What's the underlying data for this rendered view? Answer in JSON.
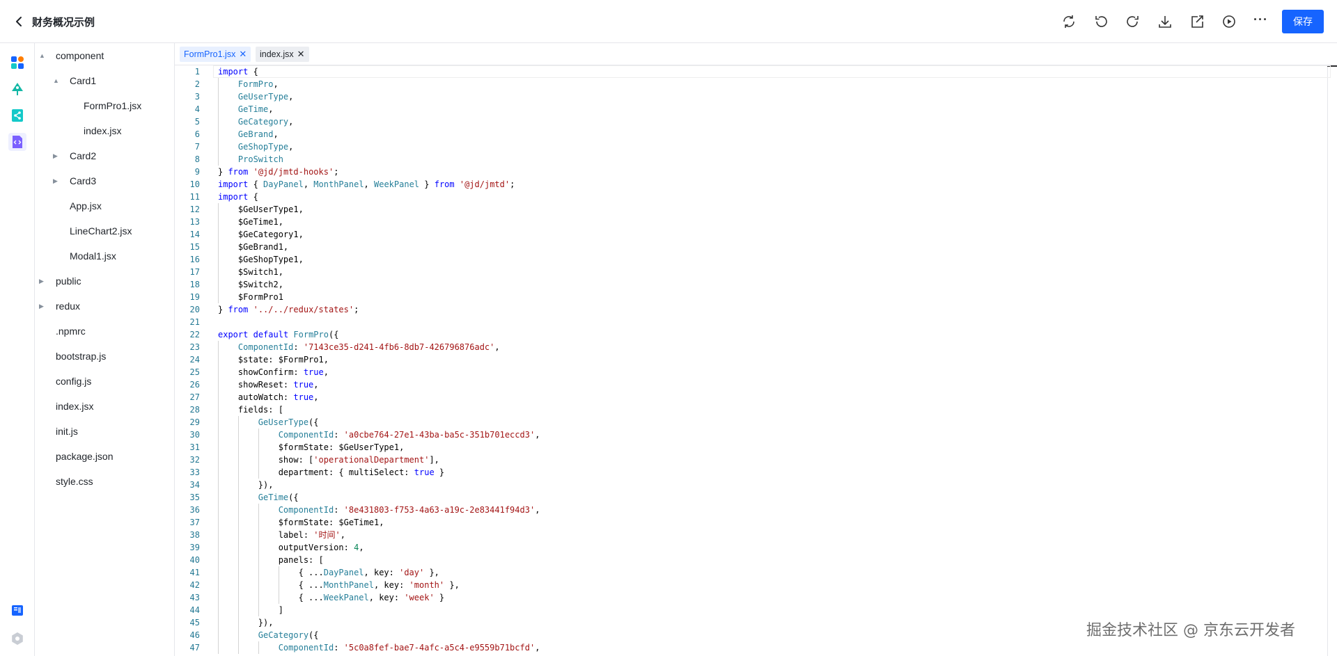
{
  "header": {
    "back_label": "‹",
    "title": "财务概况示例",
    "save_label": "保存",
    "more_label": "···"
  },
  "tree": {
    "items": [
      {
        "label": "component",
        "caret": "▲"
      },
      {
        "label": "Card1",
        "caret": "▲"
      },
      {
        "label": "FormPro1.jsx",
        "caret": ""
      },
      {
        "label": "index.jsx",
        "caret": ""
      },
      {
        "label": "Card2",
        "caret": "▶"
      },
      {
        "label": "Card3",
        "caret": "▶"
      },
      {
        "label": "App.jsx",
        "caret": ""
      },
      {
        "label": "LineChart2.jsx",
        "caret": ""
      },
      {
        "label": "Modal1.jsx",
        "caret": ""
      },
      {
        "label": "public",
        "caret": "▶"
      },
      {
        "label": "redux",
        "caret": "▶"
      },
      {
        "label": ".npmrc",
        "caret": ""
      },
      {
        "label": "bootstrap.js",
        "caret": ""
      },
      {
        "label": "config.js",
        "caret": ""
      },
      {
        "label": "index.jsx",
        "caret": ""
      },
      {
        "label": "init.js",
        "caret": ""
      },
      {
        "label": "package.json",
        "caret": ""
      },
      {
        "label": "style.css",
        "caret": ""
      }
    ]
  },
  "tabs": [
    {
      "label": "FormPro1.jsx",
      "close": "✕"
    },
    {
      "label": "index.jsx",
      "close": "✕"
    }
  ],
  "editor": {
    "lines": [
      [
        [
          "kw",
          "import"
        ],
        [
          "p",
          " {"
        ]
      ],
      [
        [
          "p",
          "    "
        ],
        [
          "ty",
          "FormPro"
        ],
        [
          "p",
          ","
        ]
      ],
      [
        [
          "p",
          "    "
        ],
        [
          "ty",
          "GeUserType"
        ],
        [
          "p",
          ","
        ]
      ],
      [
        [
          "p",
          "    "
        ],
        [
          "ty",
          "GeTime"
        ],
        [
          "p",
          ","
        ]
      ],
      [
        [
          "p",
          "    "
        ],
        [
          "ty",
          "GeCategory"
        ],
        [
          "p",
          ","
        ]
      ],
      [
        [
          "p",
          "    "
        ],
        [
          "ty",
          "GeBrand"
        ],
        [
          "p",
          ","
        ]
      ],
      [
        [
          "p",
          "    "
        ],
        [
          "ty",
          "GeShopType"
        ],
        [
          "p",
          ","
        ]
      ],
      [
        [
          "p",
          "    "
        ],
        [
          "ty",
          "ProSwitch"
        ]
      ],
      [
        [
          "p",
          "} "
        ],
        [
          "kw",
          "from"
        ],
        [
          "p",
          " "
        ],
        [
          "st",
          "'@jd/jmtd-hooks'"
        ],
        [
          "p",
          ";"
        ]
      ],
      [
        [
          "kw",
          "import"
        ],
        [
          "p",
          " { "
        ],
        [
          "ty",
          "DayPanel"
        ],
        [
          "p",
          ", "
        ],
        [
          "ty",
          "MonthPanel"
        ],
        [
          "p",
          ", "
        ],
        [
          "ty",
          "WeekPanel"
        ],
        [
          "p",
          " } "
        ],
        [
          "kw",
          "from"
        ],
        [
          "p",
          " "
        ],
        [
          "st",
          "'@jd/jmtd'"
        ],
        [
          "p",
          ";"
        ]
      ],
      [
        [
          "kw",
          "import"
        ],
        [
          "p",
          " {"
        ]
      ],
      [
        [
          "p",
          "    $GeUserType1,"
        ]
      ],
      [
        [
          "p",
          "    $GeTime1,"
        ]
      ],
      [
        [
          "p",
          "    $GeCategory1,"
        ]
      ],
      [
        [
          "p",
          "    $GeBrand1,"
        ]
      ],
      [
        [
          "p",
          "    $GeShopType1,"
        ]
      ],
      [
        [
          "p",
          "    $Switch1,"
        ]
      ],
      [
        [
          "p",
          "    $Switch2,"
        ]
      ],
      [
        [
          "p",
          "    $FormPro1"
        ]
      ],
      [
        [
          "p",
          "} "
        ],
        [
          "kw",
          "from"
        ],
        [
          "p",
          " "
        ],
        [
          "st",
          "'../../redux/states'"
        ],
        [
          "p",
          ";"
        ]
      ],
      [
        [
          "p",
          ""
        ]
      ],
      [
        [
          "kw",
          "export"
        ],
        [
          "p",
          " "
        ],
        [
          "kw",
          "default"
        ],
        [
          "p",
          " "
        ],
        [
          "ty",
          "FormPro"
        ],
        [
          "p",
          "({"
        ]
      ],
      [
        [
          "p",
          "    "
        ],
        [
          "ty",
          "ComponentId"
        ],
        [
          "p",
          ": "
        ],
        [
          "st",
          "'7143ce35-d241-4fb6-8db7-426796876adc'"
        ],
        [
          "p",
          ","
        ]
      ],
      [
        [
          "p",
          "    $state: $FormPro1,"
        ]
      ],
      [
        [
          "p",
          "    showConfirm: "
        ],
        [
          "kw",
          "true"
        ],
        [
          "p",
          ","
        ]
      ],
      [
        [
          "p",
          "    showReset: "
        ],
        [
          "kw",
          "true"
        ],
        [
          "p",
          ","
        ]
      ],
      [
        [
          "p",
          "    autoWatch: "
        ],
        [
          "kw",
          "true"
        ],
        [
          "p",
          ","
        ]
      ],
      [
        [
          "p",
          "    fields: ["
        ]
      ],
      [
        [
          "p",
          "        "
        ],
        [
          "ty",
          "GeUserType"
        ],
        [
          "p",
          "({"
        ]
      ],
      [
        [
          "p",
          "            "
        ],
        [
          "ty",
          "ComponentId"
        ],
        [
          "p",
          ": "
        ],
        [
          "st",
          "'a0cbe764-27e1-43ba-ba5c-351b701eccd3'"
        ],
        [
          "p",
          ","
        ]
      ],
      [
        [
          "p",
          "            $formState: $GeUserType1,"
        ]
      ],
      [
        [
          "p",
          "            show: ["
        ],
        [
          "st",
          "'operationalDepartment'"
        ],
        [
          "p",
          "],"
        ]
      ],
      [
        [
          "p",
          "            department: { multiSelect: "
        ],
        [
          "kw",
          "true"
        ],
        [
          "p",
          " }"
        ]
      ],
      [
        [
          "p",
          "        }),"
        ]
      ],
      [
        [
          "p",
          "        "
        ],
        [
          "ty",
          "GeTime"
        ],
        [
          "p",
          "({"
        ]
      ],
      [
        [
          "p",
          "            "
        ],
        [
          "ty",
          "ComponentId"
        ],
        [
          "p",
          ": "
        ],
        [
          "st",
          "'8e431803-f753-4a63-a19c-2e83441f94d3'"
        ],
        [
          "p",
          ","
        ]
      ],
      [
        [
          "p",
          "            $formState: $GeTime1,"
        ]
      ],
      [
        [
          "p",
          "            label: "
        ],
        [
          "st",
          "'时间'"
        ],
        [
          "p",
          ","
        ]
      ],
      [
        [
          "p",
          "            outputVersion: "
        ],
        [
          "nm",
          "4"
        ],
        [
          "p",
          ","
        ]
      ],
      [
        [
          "p",
          "            panels: ["
        ]
      ],
      [
        [
          "p",
          "                { ..."
        ],
        [
          "ty",
          "DayPanel"
        ],
        [
          "p",
          ", key: "
        ],
        [
          "st",
          "'day'"
        ],
        [
          "p",
          " },"
        ]
      ],
      [
        [
          "p",
          "                { ..."
        ],
        [
          "ty",
          "MonthPanel"
        ],
        [
          "p",
          ", key: "
        ],
        [
          "st",
          "'month'"
        ],
        [
          "p",
          " },"
        ]
      ],
      [
        [
          "p",
          "                { ..."
        ],
        [
          "ty",
          "WeekPanel"
        ],
        [
          "p",
          ", key: "
        ],
        [
          "st",
          "'week'"
        ],
        [
          "p",
          " }"
        ]
      ],
      [
        [
          "p",
          "            ]"
        ]
      ],
      [
        [
          "p",
          "        }),"
        ]
      ],
      [
        [
          "p",
          "        "
        ],
        [
          "ty",
          "GeCategory"
        ],
        [
          "p",
          "({"
        ]
      ],
      [
        [
          "p",
          "            "
        ],
        [
          "ty",
          "ComponentId"
        ],
        [
          "p",
          ": "
        ],
        [
          "st",
          "'5c0a8fef-bae7-4afc-a5c4-e9559b71bcfd'"
        ],
        [
          "p",
          ","
        ]
      ]
    ]
  },
  "watermark": "掘金技术社区 @ 京东云开发者"
}
